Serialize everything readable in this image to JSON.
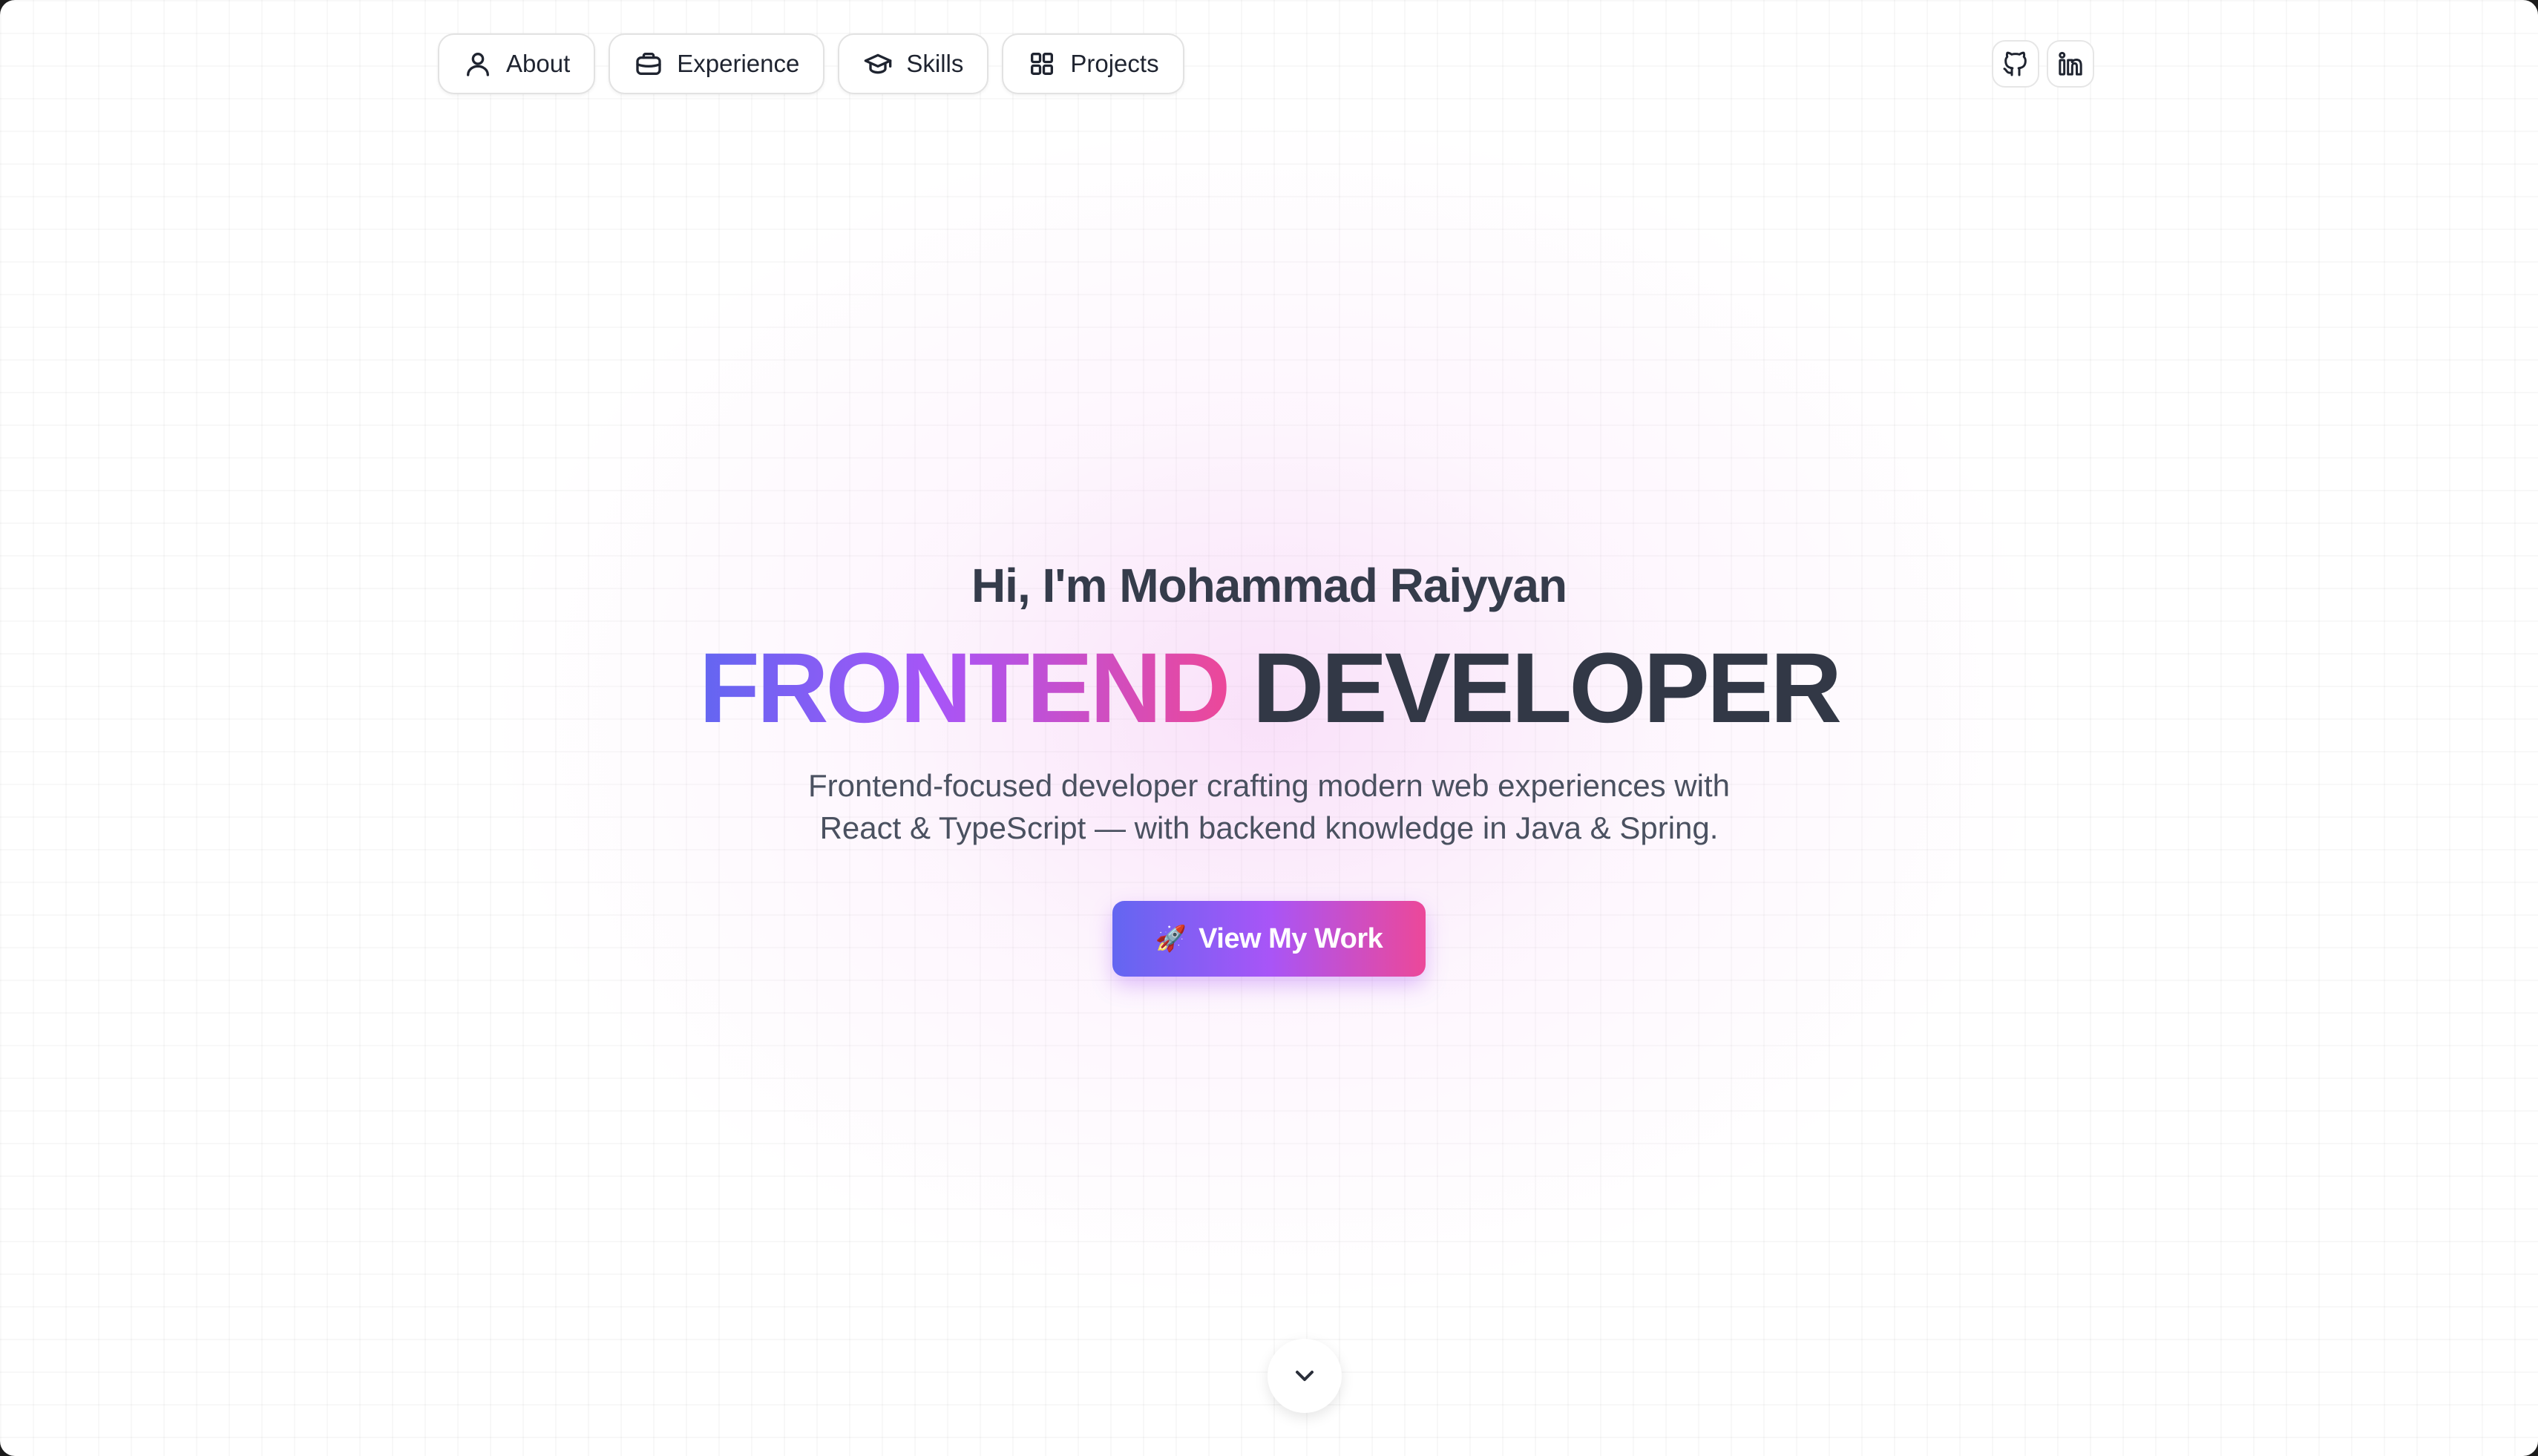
{
  "nav": {
    "items": [
      {
        "label": "About",
        "icon": "user-icon"
      },
      {
        "label": "Experience",
        "icon": "briefcase-icon"
      },
      {
        "label": "Skills",
        "icon": "graduation-cap-icon"
      },
      {
        "label": "Projects",
        "icon": "grid-icon"
      }
    ]
  },
  "social": {
    "items": [
      {
        "icon": "github-icon"
      },
      {
        "icon": "linkedin-icon"
      }
    ]
  },
  "hero": {
    "greeting": "Hi, I'm Mohammad Raiyyan",
    "title_highlight": "FRONTEND",
    "title_rest": "DEVELOPER",
    "description_line1": "Frontend-focused developer crafting modern web experiences with",
    "description_line2": "React & TypeScript — with backend knowledge in Java & Spring.",
    "cta_emoji": "🚀",
    "cta_label": "View My Work"
  },
  "scroll_indicator": {
    "icon": "chevron-down-icon"
  },
  "colors": {
    "gradient_start": "#6366f1",
    "gradient_mid": "#a855f7",
    "gradient_end": "#ec4899",
    "text_dark": "#323846",
    "text_body": "#4a5160"
  }
}
